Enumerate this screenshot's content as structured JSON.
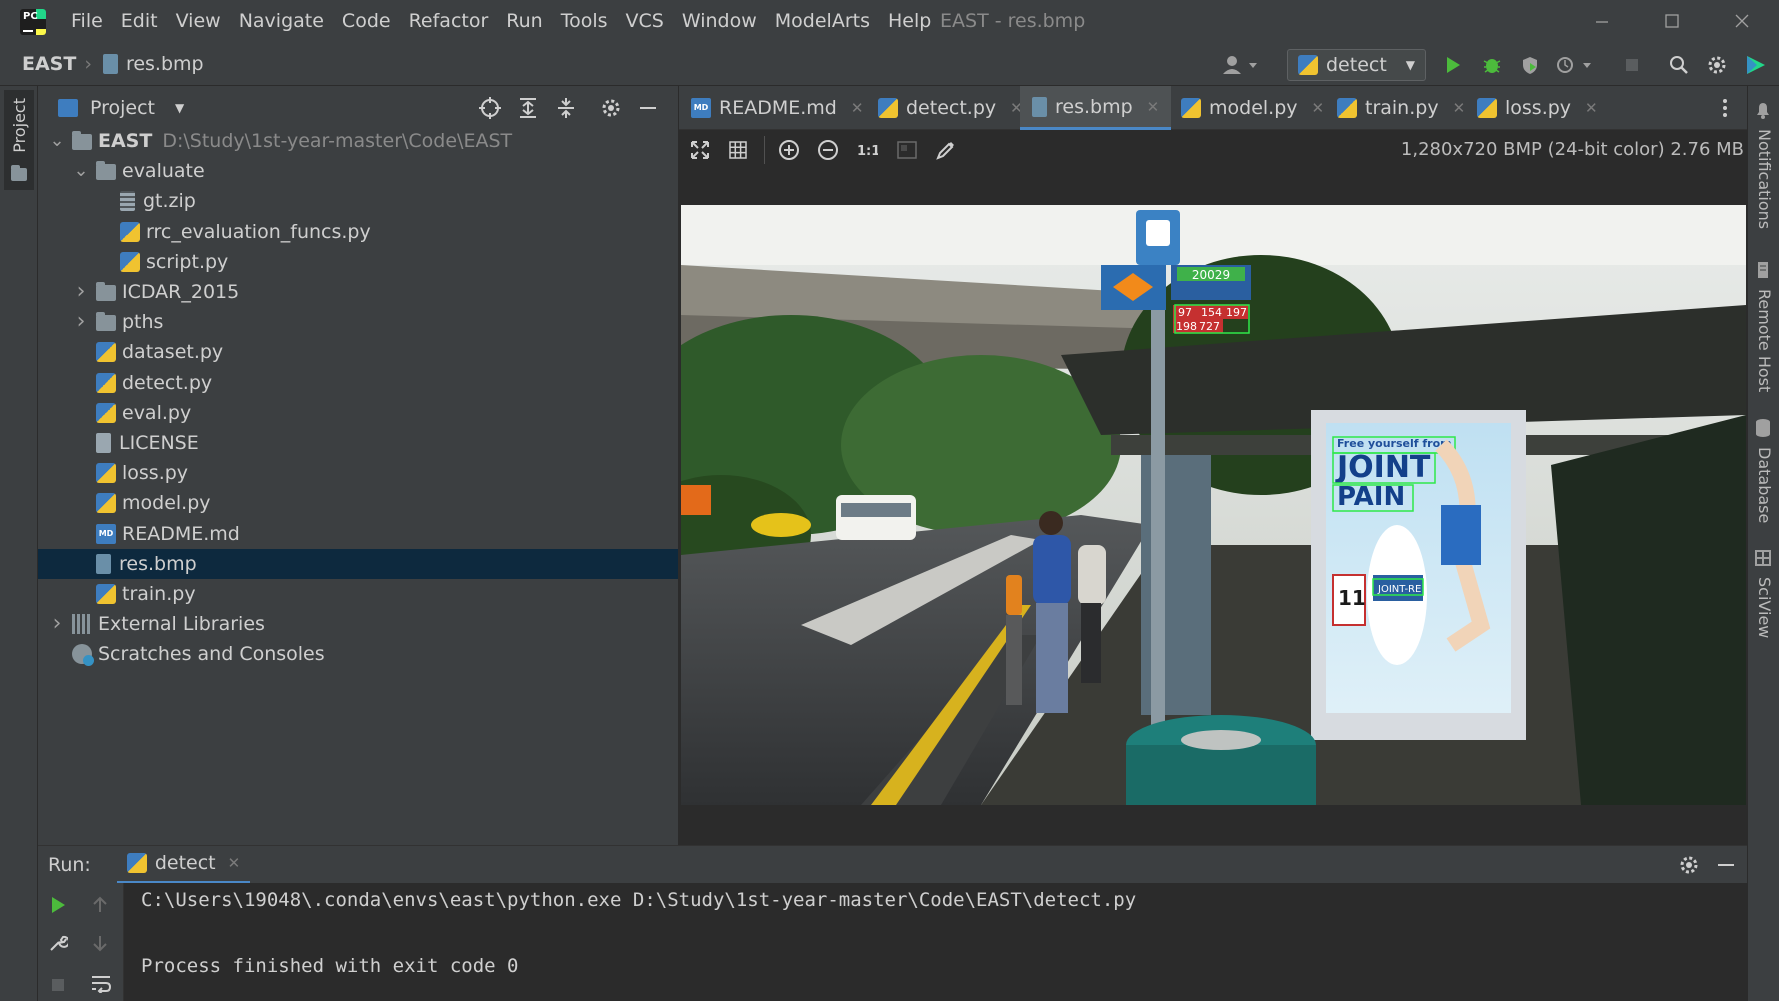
{
  "window": {
    "title": "EAST - res.bmp",
    "menu": [
      "File",
      "Edit",
      "View",
      "Navigate",
      "Code",
      "Refactor",
      "Run",
      "Tools",
      "VCS",
      "Window",
      "ModelArts",
      "Help"
    ]
  },
  "breadcrumb": {
    "project": "EAST",
    "file": "res.bmp"
  },
  "toolbar": {
    "run_config": "detect"
  },
  "left_stripe": {
    "project_label": "Project"
  },
  "right_stripe": {
    "items": [
      "Notifications",
      "Remote Host",
      "Database",
      "SciView"
    ]
  },
  "project_panel": {
    "title": "Project",
    "tree": [
      {
        "label": "EAST",
        "path": "D:\\Study\\1st-year-master\\Code\\EAST",
        "type": "folder",
        "expanded": true,
        "depth": 0
      },
      {
        "label": "evaluate",
        "type": "folder",
        "expanded": true,
        "depth": 1
      },
      {
        "label": "gt.zip",
        "type": "zip",
        "depth": 2
      },
      {
        "label": "rrc_evaluation_funcs.py",
        "type": "py",
        "depth": 2
      },
      {
        "label": "script.py",
        "type": "py",
        "depth": 2
      },
      {
        "label": "ICDAR_2015",
        "type": "folder",
        "expanded": false,
        "depth": 1
      },
      {
        "label": "pths",
        "type": "folder",
        "expanded": false,
        "depth": 1
      },
      {
        "label": "dataset.py",
        "type": "py",
        "depth": 1
      },
      {
        "label": "detect.py",
        "type": "py",
        "depth": 1
      },
      {
        "label": "eval.py",
        "type": "py",
        "depth": 1
      },
      {
        "label": "LICENSE",
        "type": "file",
        "depth": 1
      },
      {
        "label": "loss.py",
        "type": "py",
        "depth": 1
      },
      {
        "label": "model.py",
        "type": "py",
        "depth": 1
      },
      {
        "label": "README.md",
        "type": "md",
        "depth": 1
      },
      {
        "label": "res.bmp",
        "type": "bmp",
        "depth": 1,
        "selected": true
      },
      {
        "label": "train.py",
        "type": "py",
        "depth": 1
      },
      {
        "label": "External Libraries",
        "type": "lib",
        "expanded": false,
        "depth": 0
      },
      {
        "label": "Scratches and Consoles",
        "type": "scratch",
        "depth": 0
      }
    ]
  },
  "editor": {
    "tabs": [
      {
        "label": "README.md",
        "icon": "md",
        "active": false
      },
      {
        "label": "detect.py",
        "icon": "py",
        "active": false
      },
      {
        "label": "res.bmp",
        "icon": "bmp",
        "active": true
      },
      {
        "label": "model.py",
        "icon": "py",
        "active": false
      },
      {
        "label": "train.py",
        "icon": "py",
        "active": false
      },
      {
        "label": "loss.py",
        "icon": "py",
        "active": false
      }
    ],
    "image_info": "1,280x720 BMP (24-bit color) 2.76 MB",
    "image_text": {
      "bus_stop_code": "20029",
      "bus_numbers_row1": [
        "97",
        "154",
        "197"
      ],
      "bus_numbers_row2": [
        "198",
        "727"
      ],
      "ad_small": "Free yourself from",
      "ad_line1": "JOINT",
      "ad_line2": "PAIN",
      "ad_product": "JOINT-RE",
      "ad_number": "11"
    }
  },
  "run_panel": {
    "label": "Run:",
    "tab": "detect",
    "lines": [
      "C:\\Users\\19048\\.conda\\envs\\east\\python.exe D:\\Study\\1st-year-master\\Code\\EAST\\detect.py",
      "",
      "Process finished with exit code 0"
    ]
  },
  "colors": {
    "background": "#2b2b2b",
    "panel": "#3c3f41",
    "selection": "#0d293e",
    "accent": "#4a88c7",
    "run_green": "#4cbb3c",
    "detection_box": "#2ee84a"
  }
}
